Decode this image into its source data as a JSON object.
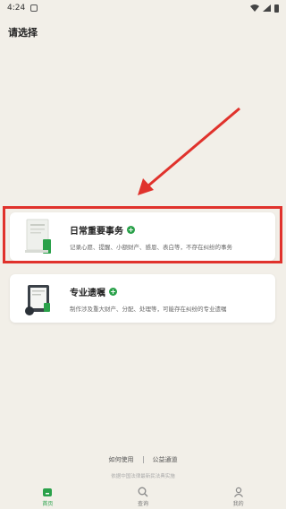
{
  "status": {
    "time": "4:24"
  },
  "page": {
    "title": "请选择"
  },
  "cards": [
    {
      "title": "日常重要事务",
      "description": "记录心愿、提醒、小额财产、感恩、表白等，不存在纠纷的事务",
      "plus": "+"
    },
    {
      "title": "专业遗嘱",
      "description": "制作涉及重大财产、分配、处理等，可能存在纠纷的专业遗嘱",
      "plus": "+"
    }
  ],
  "footer": {
    "link_how": "如何使用",
    "link_public": "公益通道",
    "note": "依据中国法律最新民法典实施"
  },
  "tabs": [
    {
      "label": "首页"
    },
    {
      "label": "查询"
    },
    {
      "label": "我的"
    }
  ],
  "colors": {
    "accent": "#2aa14a",
    "highlight": "#e0322c",
    "background": "#f2efe8"
  }
}
